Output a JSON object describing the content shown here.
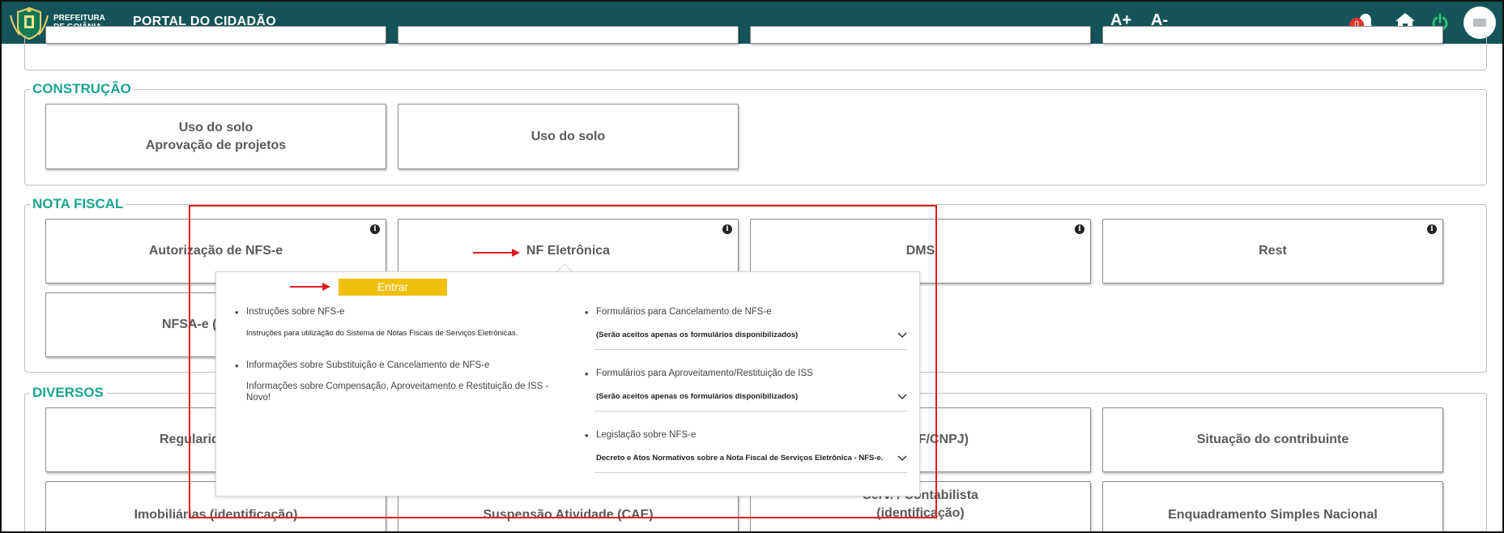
{
  "header": {
    "logo_text_line1": "PREFEITURA",
    "logo_text_line2": "DE GOIÂNIA",
    "title": "PORTAL DO CIDADÃO",
    "font_increase": "A+",
    "font_decrease": "A-",
    "notification_count": "0",
    "colors": {
      "bar": "#145459",
      "badge": "#e0332e",
      "power": "#2ecc71"
    }
  },
  "sections": {
    "construcao": {
      "title": "CONSTRUÇÃO",
      "cards": [
        {
          "line1": "Uso do solo",
          "line2": "Aprovação de projetos"
        },
        {
          "line1": "Uso do solo"
        }
      ]
    },
    "nota_fiscal": {
      "title": "NOTA FISCAL",
      "cards": [
        {
          "label": "Autorização de NFS-e",
          "info": "i"
        },
        {
          "label": "NF Eletrônica",
          "info": "i"
        },
        {
          "label": "DMS",
          "info": "i"
        },
        {
          "label": "Rest",
          "info": "i"
        },
        {
          "label": "NFSA-e (i"
        }
      ]
    },
    "diversos": {
      "title": "DIVERSOS",
      "cards": [
        {
          "label": "Regularid"
        },
        {
          "label": "F/CNPJ)"
        },
        {
          "label": "Situação do contribuinte"
        },
        {
          "label": "Imobiliárias (identificação)"
        },
        {
          "label": "Suspensão Atividade (CAE)"
        },
        {
          "line1": "Serv. / Contabilista",
          "line2": "(identificação)"
        },
        {
          "label": "Enquadramento Simples Nacional"
        }
      ]
    }
  },
  "popup": {
    "enter_label": "Entrar",
    "left": [
      {
        "title": "Instruções sobre NFS-e",
        "desc": "Instruções para utilização do Sistema de Notas Fiscais de Serviços Eletrônicas."
      },
      {
        "title": "Informações sobre Substituição e Cancelamento de NFS-e"
      },
      {
        "title_line1": "Informações sobre Compensação, Aproveitamento e Restituição de ISS -",
        "title_line2": "Novo!"
      }
    ],
    "right": [
      {
        "title": "Formulários para Cancelamento de NFS-e",
        "desc": "(Serão aceitos apenas os formulários disponibilizados)"
      },
      {
        "title": "Formulários para Aproveitamento/Restituição de ISS",
        "desc": "(Serão aceitos apenas os formulários disponibilizados)"
      },
      {
        "title": "Legislação sobre NFS-e",
        "desc": "Decreto e Atos Normativos sobre a Nota Fiscal de Serviços Eletrônica - NFS-e."
      }
    ]
  },
  "annotations": {
    "highlight_color": "#e0191e"
  }
}
